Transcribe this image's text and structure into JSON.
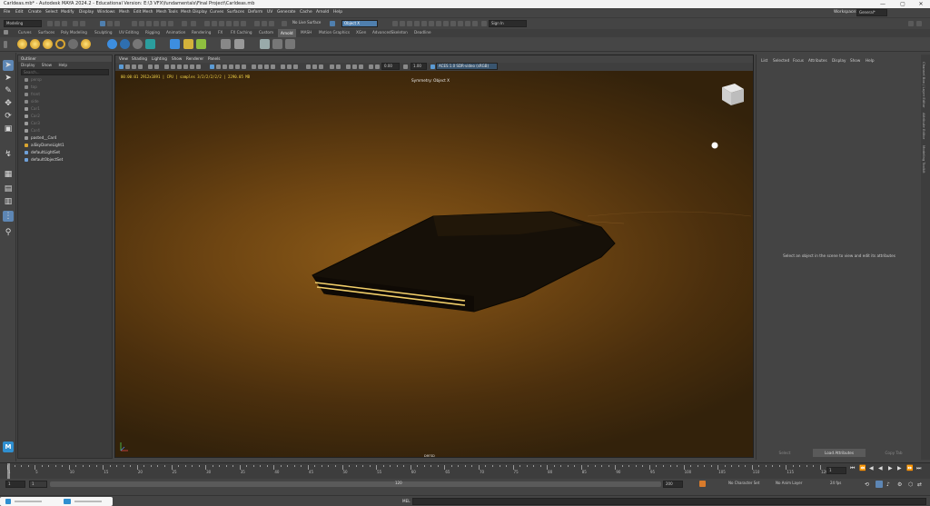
{
  "window": {
    "title": "Carldeas.mb* - Autodesk MAYA 2024.2 - Educational Version: E:\\3 VFX\\fundamentals\\Final Project\\Carldeas.mb",
    "controls": [
      "—",
      "▢",
      "✕"
    ]
  },
  "menubar": {
    "items": [
      "File",
      "Edit",
      "Create",
      "Select",
      "Modify",
      "Display",
      "Windows",
      "Mesh",
      "Edit Mesh",
      "Mesh Tools",
      "Mesh Display",
      "Curves",
      "Surfaces",
      "Deform",
      "UV",
      "Generate",
      "Cache",
      "Arnold",
      "Help"
    ],
    "workspace_label": "Workspace:",
    "workspace_value": "General*"
  },
  "statusline": {
    "mode": "Modeling",
    "live_surface": "No Live Surface",
    "object_field": "Object X",
    "sign_in": "Sign In"
  },
  "shelf": {
    "tabs": [
      "Curves",
      "Surfaces",
      "Poly Modeling",
      "Sculpting",
      "UV Editing",
      "Rigging",
      "Animation",
      "Rendering",
      "FX",
      "FX Caching",
      "Custom",
      "Arnold",
      "MASH",
      "Motion Graphics",
      "XGen",
      "AdvancedSkeleton",
      "Deadline"
    ],
    "active_tab": "Arnold"
  },
  "outliner": {
    "title": "Outliner",
    "menu": [
      "Display",
      "Show",
      "Help"
    ],
    "search_placeholder": "Search...",
    "items": [
      {
        "label": "persp",
        "kind": "camera",
        "dim": true
      },
      {
        "label": "top",
        "kind": "camera",
        "dim": true
      },
      {
        "label": "front",
        "kind": "camera",
        "dim": true
      },
      {
        "label": "side",
        "kind": "camera",
        "dim": true
      },
      {
        "label": "Car1",
        "kind": "mesh",
        "dim": true
      },
      {
        "label": "Car2",
        "kind": "mesh",
        "dim": true
      },
      {
        "label": "Car3",
        "kind": "mesh",
        "dim": true
      },
      {
        "label": "Car4",
        "kind": "mesh",
        "dim": true
      },
      {
        "label": "pasted__Car4",
        "kind": "mesh",
        "dim": false
      },
      {
        "label": "aiSkyDomeLight1",
        "kind": "light",
        "dim": false
      },
      {
        "label": "defaultLightSet",
        "kind": "set",
        "dim": false
      },
      {
        "label": "defaultObjectSet",
        "kind": "set",
        "dim": false
      }
    ]
  },
  "viewport": {
    "menu": [
      "View",
      "Shading",
      "Lighting",
      "Show",
      "Renderer",
      "Panels"
    ],
    "exposure": "0.00",
    "gamma": "1.00",
    "colorspace": "ACES 1.0 SDR-video (sRGB)",
    "hud_line": "00:00:01 2912x1891 | CPU | samples 3/2/2/2/2/2 | 2290.05 MB",
    "symmetry": "Symmetry: Object X",
    "camera": "persp"
  },
  "attribute_editor": {
    "menu": [
      "List",
      "Selected",
      "Focus",
      "Attributes",
      "Display",
      "Show",
      "Help"
    ],
    "message": "Select an object in the scene to view and edit its attributes",
    "buttons": [
      "Select",
      "Load Attributes",
      "Copy Tab"
    ],
    "side_tabs": [
      "Channel Box / Layer Editor",
      "Attribute Editor",
      "Modeling Toolkit"
    ]
  },
  "timeslider": {
    "tick_labels": [
      "1",
      "5",
      "10",
      "15",
      "20",
      "25",
      "30",
      "35",
      "40",
      "45",
      "50",
      "55",
      "60",
      "65",
      "70",
      "75",
      "80",
      "85",
      "90",
      "95",
      "100",
      "105",
      "110",
      "115",
      "120"
    ],
    "current_frame": "1"
  },
  "range": {
    "start": "1",
    "inner_start": "1",
    "inner_end": "120",
    "end_a": "120",
    "end_b": "200",
    "character_set": "No Character Set",
    "anim_layer": "No Anim Layer",
    "fps": "24 fps"
  },
  "cmdline": {
    "lang": "MEL"
  },
  "colors": {
    "accent": "#5d86b4",
    "hud_yellow": "#f6d74a",
    "brand": "#2f8fd0"
  }
}
